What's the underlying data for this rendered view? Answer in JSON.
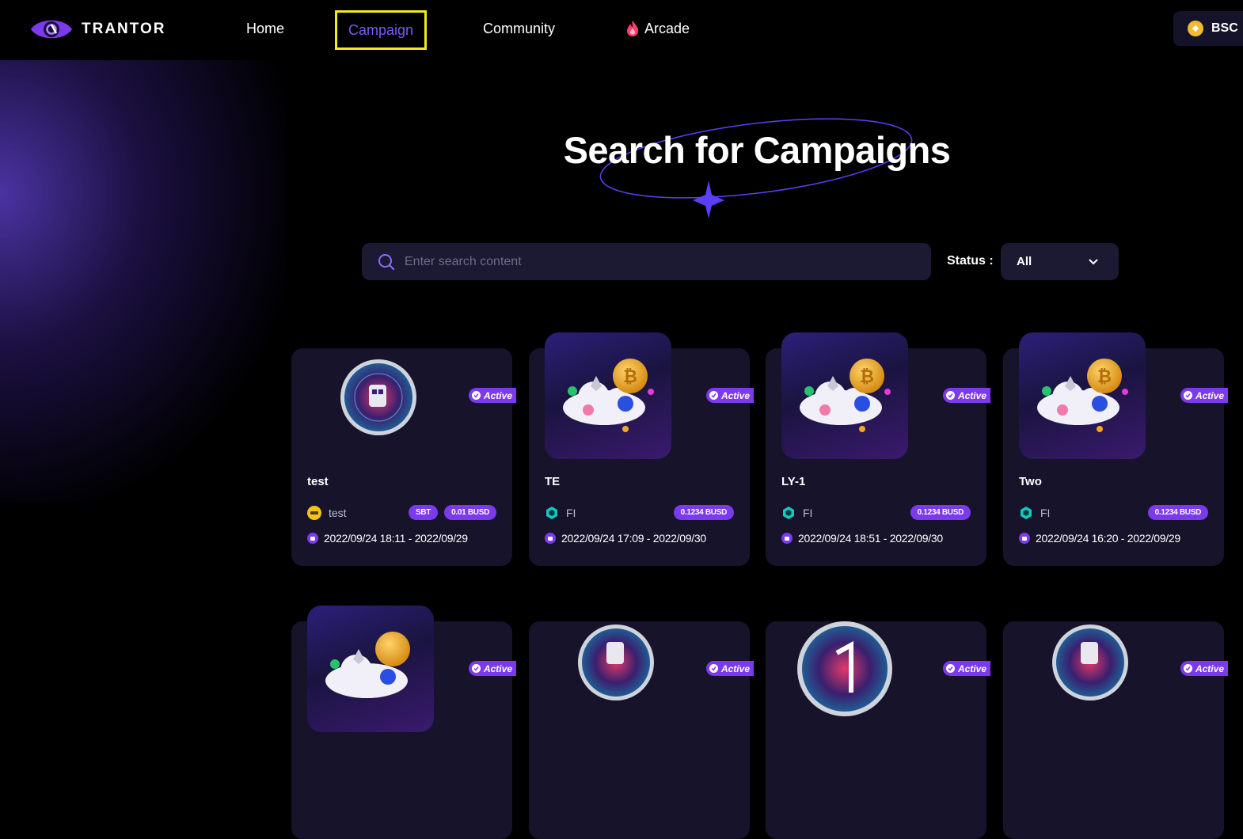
{
  "brand": {
    "name": "TRANTOR"
  },
  "nav": [
    {
      "label": "Home"
    },
    {
      "label": "Campaign"
    },
    {
      "label": "Community"
    },
    {
      "label": "Arcade"
    }
  ],
  "network": {
    "label": "BSC"
  },
  "page": {
    "title": "Search for Campaigns"
  },
  "search": {
    "placeholder": "Enter search content"
  },
  "filter": {
    "label": "Status :",
    "value": "All"
  },
  "cards": [
    {
      "name": "test",
      "project": "test",
      "tags": [
        "SBT",
        "0.01 BUSD"
      ],
      "dates": "2022/09/24 18:11 - 2022/09/29",
      "status": "Active"
    },
    {
      "name": "TE",
      "project": "FI",
      "tags": [
        "0.1234 BUSD"
      ],
      "dates": "2022/09/24 17:09 - 2022/09/30",
      "status": "Active"
    },
    {
      "name": "LY-1",
      "project": "FI",
      "tags": [
        "0.1234 BUSD"
      ],
      "dates": "2022/09/24 18:51 - 2022/09/30",
      "status": "Active"
    },
    {
      "name": "Two",
      "project": "FI",
      "tags": [
        "0.1234 BUSD"
      ],
      "dates": "2022/09/24 16:20 - 2022/09/29",
      "status": "Active"
    },
    {
      "status": "Active"
    },
    {
      "status": "Active"
    },
    {
      "status": "Active"
    },
    {
      "status": "Active"
    }
  ],
  "colors": {
    "accent": "#7c3aed",
    "highlight": "#f2ec18",
    "card": "#16132b"
  }
}
